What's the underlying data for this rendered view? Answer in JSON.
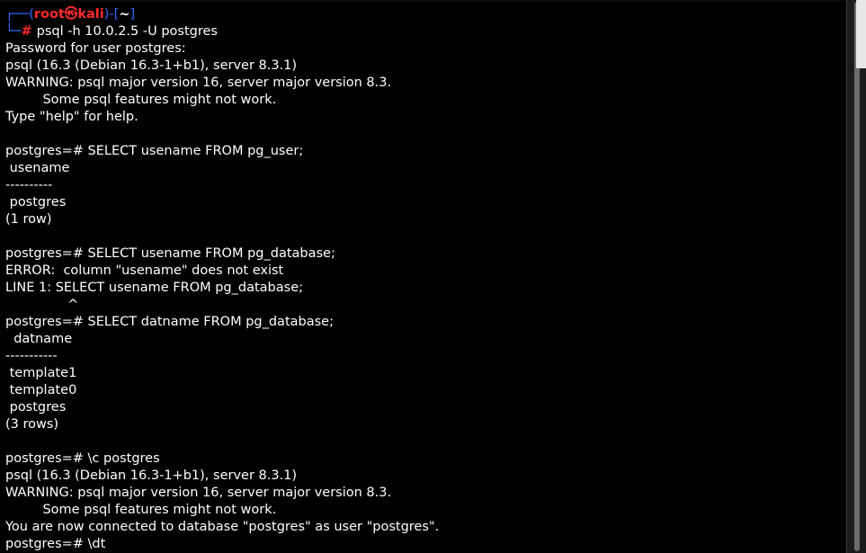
{
  "prompt": {
    "box_open": "┌──(",
    "user": "root㉿kali",
    "box_mid": ")-[",
    "cwd": "~",
    "box_close": "]",
    "corner": "└─",
    "hash": "# ",
    "command": "psql -h 10.0.2.5 -U postgres"
  },
  "output_lines": [
    "Password for user postgres:",
    "psql (16.3 (Debian 16.3-1+b1), server 8.3.1)",
    "WARNING: psql major version 16, server major version 8.3.",
    "         Some psql features might not work.",
    "Type \"help\" for help.",
    "",
    "postgres=# SELECT usename FROM pg_user;",
    " usename",
    "----------",
    " postgres",
    "(1 row)",
    "",
    "postgres=# SELECT usename FROM pg_database;",
    "ERROR:  column \"usename\" does not exist",
    "LINE 1: SELECT usename FROM pg_database;",
    "               ^",
    "postgres=# SELECT datname FROM pg_database;",
    "  datname",
    "-----------",
    " template1",
    " template0",
    " postgres",
    "(3 rows)",
    "",
    "postgres=# \\c postgres",
    "psql (16.3 (Debian 16.3-1+b1), server 8.3.1)",
    "WARNING: psql major version 16, server major version 8.3.",
    "         Some psql features might not work.",
    "You are now connected to database \"postgres\" as user \"postgres\".",
    "postgres=# \\dt"
  ],
  "colors": {
    "background": "#000000",
    "text": "#ffffff",
    "prompt_box": "#2f6bff",
    "prompt_user": "#ff2b2b"
  }
}
